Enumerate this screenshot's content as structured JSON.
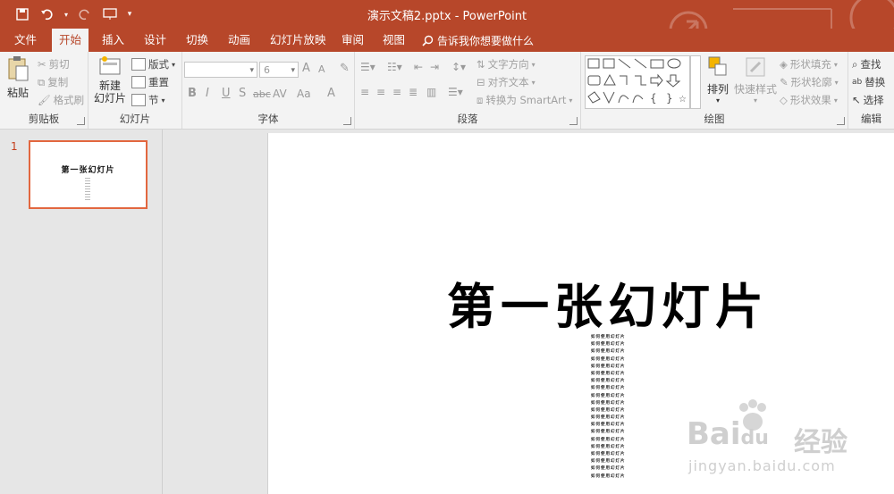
{
  "app": {
    "doc_title": "演示文稿2.pptx - PowerPoint"
  },
  "tabs": [
    {
      "label": "文件"
    },
    {
      "label": "开始"
    },
    {
      "label": "插入"
    },
    {
      "label": "设计"
    },
    {
      "label": "切换"
    },
    {
      "label": "动画"
    },
    {
      "label": "幻灯片放映"
    },
    {
      "label": "审阅"
    },
    {
      "label": "视图"
    }
  ],
  "tell_me": "告诉我你想要做什么",
  "ribbon": {
    "clipboard": {
      "label": "剪贴板",
      "paste": "粘贴",
      "cut": "剪切",
      "copy": "复制",
      "format_painter": "格式刷"
    },
    "slides": {
      "label": "幻灯片",
      "new_slide": "新建",
      "new_slide_2": "幻灯片",
      "layout": "版式",
      "reset": "重置",
      "section": "节"
    },
    "font": {
      "label": "字体",
      "font_name": "",
      "font_size": "6",
      "bold": "B",
      "italic": "I",
      "underline": "U",
      "shadow": "S",
      "strike": "abc",
      "spacing": "AV",
      "case": "Aa",
      "color": "A",
      "grow": "A",
      "shrink": "A"
    },
    "paragraph": {
      "label": "段落",
      "text_direction": "文字方向",
      "align_text": "对齐文本",
      "smartart": "转换为 SmartArt"
    },
    "drawing": {
      "label": "绘图",
      "arrange": "排列",
      "quick_styles": "快速样式",
      "shape_fill": "形状填充",
      "shape_outline": "形状轮廓",
      "shape_effects": "形状效果"
    },
    "editing": {
      "label": "编辑",
      "find": "查找",
      "replace": "替换",
      "select": "选择"
    }
  },
  "thumbnail": {
    "number": "1",
    "title": "第一张幻灯片"
  },
  "slide": {
    "title": "第一张幻灯片",
    "body_lines": [
      "如何使用幻灯片",
      "如何使用幻灯片",
      "如何使用幻灯片",
      "如何使用幻灯片",
      "如何使用幻灯片",
      "如何使用幻灯片",
      "如何使用幻灯片",
      "如何使用幻灯片",
      "如何使用幻灯片",
      "如何使用幻灯片",
      "如何使用幻灯片",
      "如何使用幻灯片",
      "如何使用幻灯片",
      "如何使用幻灯片",
      "如何使用幻灯片",
      "如何使用幻灯片",
      "如何使用幻灯片",
      "如何使用幻灯片",
      "如何使用幻灯片",
      "如何使用幻灯片"
    ]
  },
  "watermark": {
    "brand": "Bai",
    "brand2": "du",
    "cn": "经验",
    "url": "jingyan.baidu.com"
  },
  "colors": {
    "accent": "#b7472a",
    "thumb_border": "#e2673f"
  }
}
